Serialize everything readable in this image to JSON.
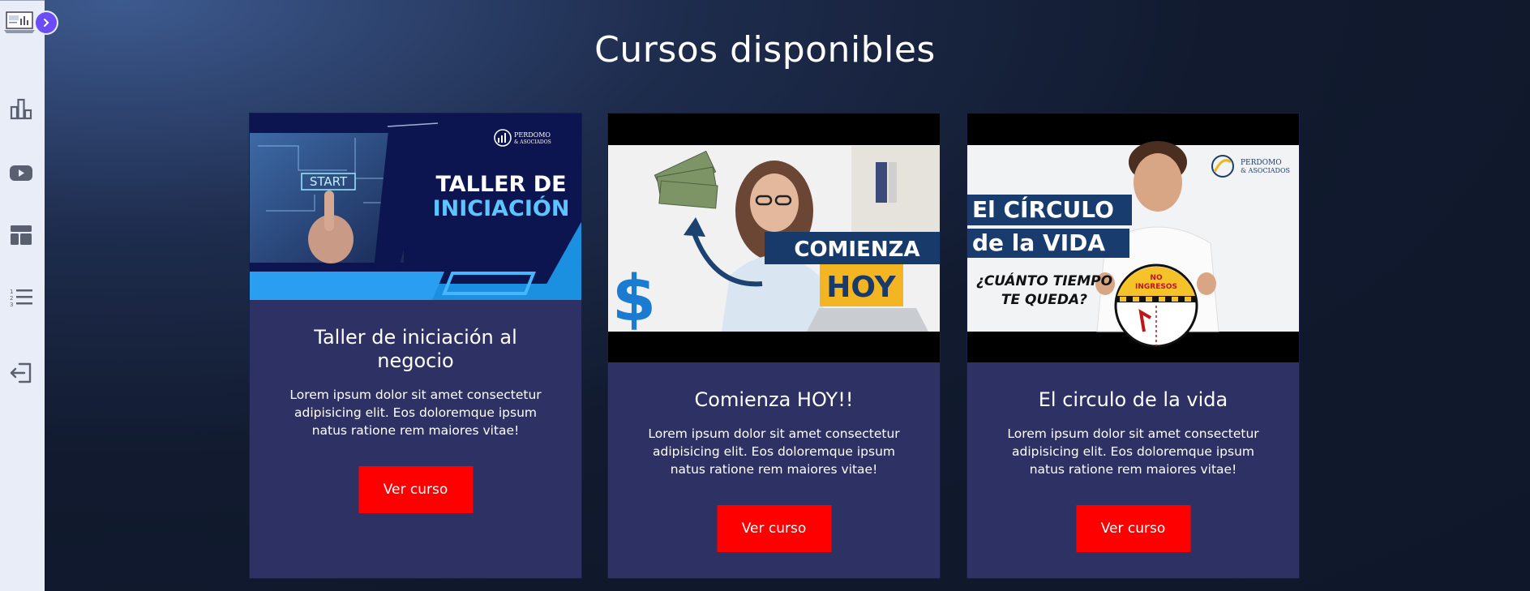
{
  "page": {
    "title": "Cursos disponibles"
  },
  "sidebar": {
    "items": [
      {
        "icon": "bar-chart-icon"
      },
      {
        "icon": "youtube-icon"
      },
      {
        "icon": "layout-icon"
      },
      {
        "icon": "numbered-list-icon"
      },
      {
        "icon": "logout-icon"
      }
    ]
  },
  "courses": [
    {
      "title": "Taller de iniciación al negocio",
      "description": "Lorem ipsum dolor sit amet consectetur adipisicing elit. Eos doloremque ipsum natus ratione rem maiores vitae!",
      "button": "Ver curso",
      "image": {
        "headline_line1": "TALLER DE",
        "headline_line2": "INICIACIÓN",
        "start_label": "START",
        "brand_line1": "PERDOMO",
        "brand_line2": "& ASOCIADOS"
      }
    },
    {
      "title": "Comienza HOY!!",
      "description": "Lorem ipsum dolor sit amet consectetur adipisicing elit. Eos doloremque ipsum natus ratione rem maiores vitae!",
      "button": "Ver curso",
      "image": {
        "headline_line1": "COMIENZA",
        "headline_line2": "HOY",
        "symbol": "$"
      }
    },
    {
      "title": "El circulo de la vida",
      "description": "Lorem ipsum dolor sit amet consectetur adipisicing elit. Eos doloremque ipsum natus ratione rem maiores vitae!",
      "button": "Ver curso",
      "image": {
        "headline_line1": "El CÍRCULO",
        "headline_line2": "de la VIDA",
        "question_line1": "¿CUÁNTO TIEMPO",
        "question_line2": "TE QUEDA?",
        "gauge_line1": "NO",
        "gauge_line2": "INGRESOS",
        "brand_line1": "PERDOMO",
        "brand_line2": "& ASOCIADOS"
      }
    }
  ],
  "colors": {
    "sidebar_bg": "#e8edf7",
    "toggle": "#6b4cf6",
    "card_bg": "#2d3163",
    "button": "#ff0000",
    "page_bg": "#0f172a"
  }
}
